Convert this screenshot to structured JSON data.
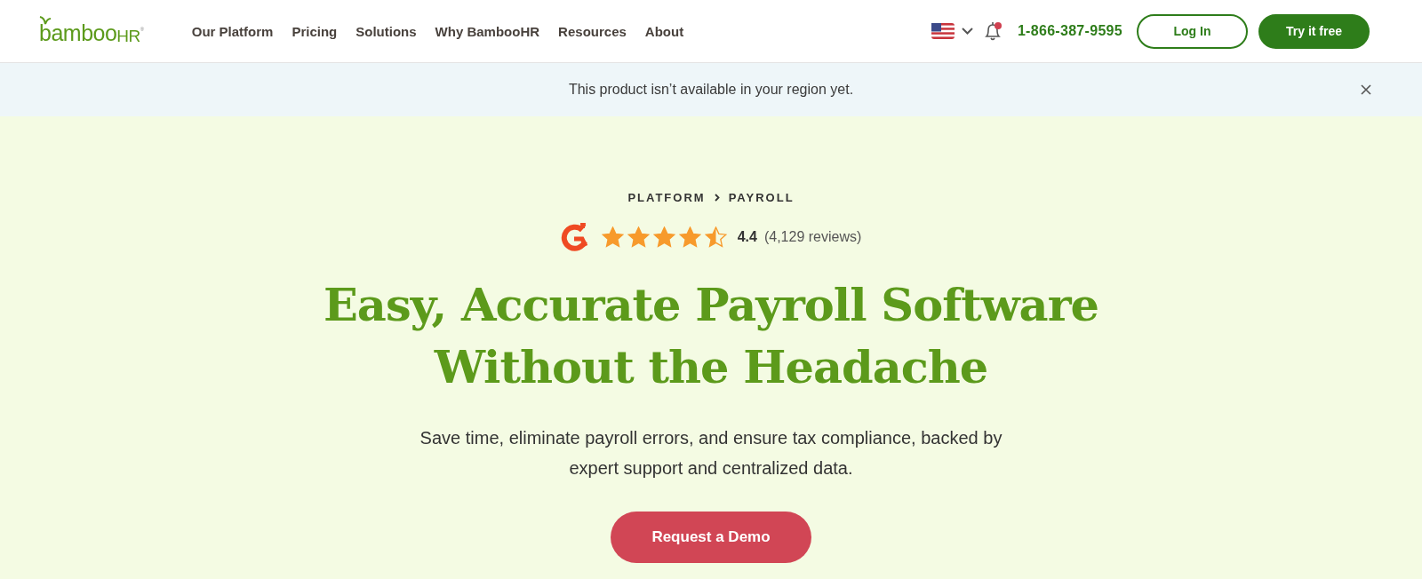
{
  "header": {
    "logo": {
      "name": "bamboo",
      "suffix": "HR",
      "mark": "®"
    },
    "nav": [
      {
        "label": "Our Platform"
      },
      {
        "label": "Pricing"
      },
      {
        "label": "Solutions"
      },
      {
        "label": "Why BambooHR"
      },
      {
        "label": "Resources"
      },
      {
        "label": "About"
      }
    ],
    "notifications": {
      "unread": true
    },
    "phone": "1-866-387-9595",
    "buttons": [
      {
        "label": "Log In",
        "kind": "outline"
      },
      {
        "label": "Try it free",
        "kind": "filled"
      }
    ]
  },
  "banner": {
    "text": "This product isn’t available in your region yet."
  },
  "hero": {
    "breadcrumb": [
      "PLATFORM",
      "PAYROLL"
    ],
    "rating": {
      "stars": 4.5,
      "score": "4.4",
      "reviews": "(4,129 reviews)"
    },
    "title": [
      "Easy, Accurate Payroll Software",
      "Without the Headache"
    ],
    "subtitle": [
      "Save time, eliminate payroll errors, and ensure tax compliance, backed by",
      "expert support and centralized data."
    ],
    "cta": "Request a Demo"
  }
}
